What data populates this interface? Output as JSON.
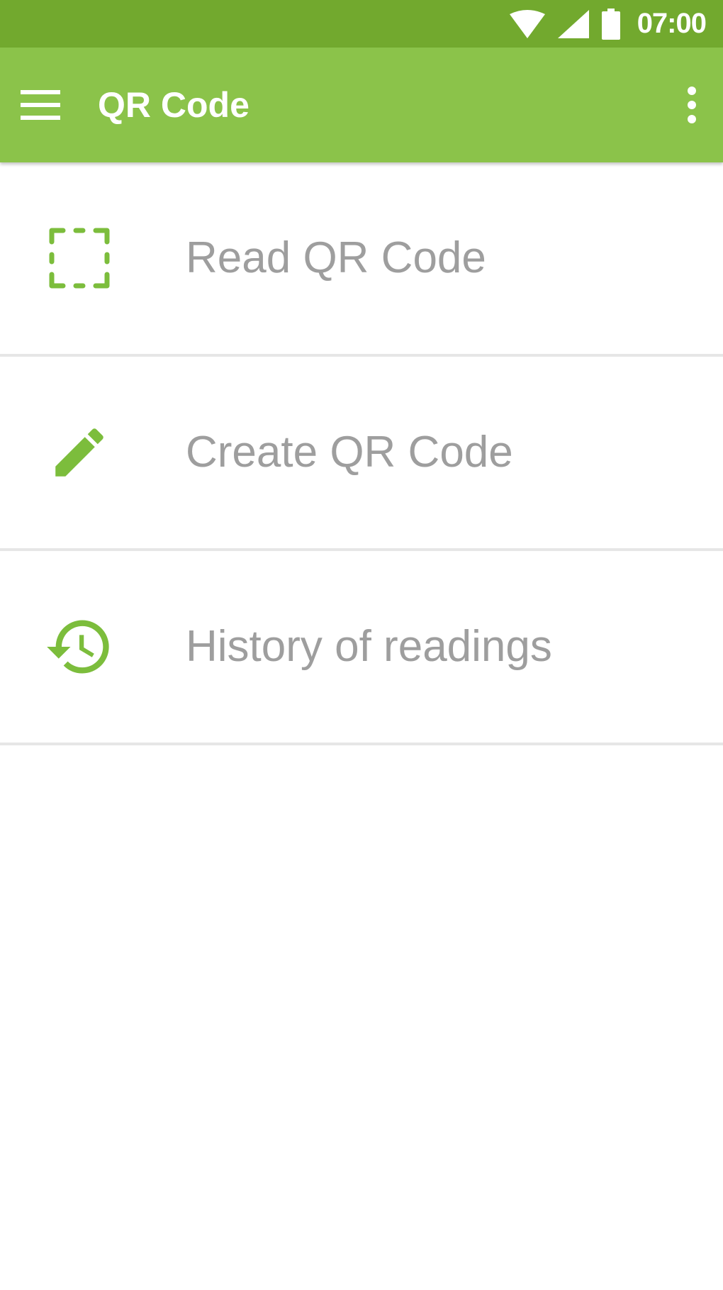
{
  "status_bar": {
    "time": "07:00",
    "icons": [
      "wifi-icon",
      "cellular-signal-icon",
      "battery-icon"
    ],
    "color": "#72a92e"
  },
  "app_bar": {
    "title": "QR Code",
    "color": "#8bc34a",
    "nav_icon": "hamburger-menu-icon",
    "overflow_icon": "more-vertical-icon"
  },
  "menu": {
    "accent_color": "#7cbd3c",
    "items": [
      {
        "label": "Read QR Code",
        "icon": "scan-frame-icon"
      },
      {
        "label": "Create QR Code",
        "icon": "pencil-icon"
      },
      {
        "label": "History of readings",
        "icon": "history-icon"
      }
    ]
  }
}
